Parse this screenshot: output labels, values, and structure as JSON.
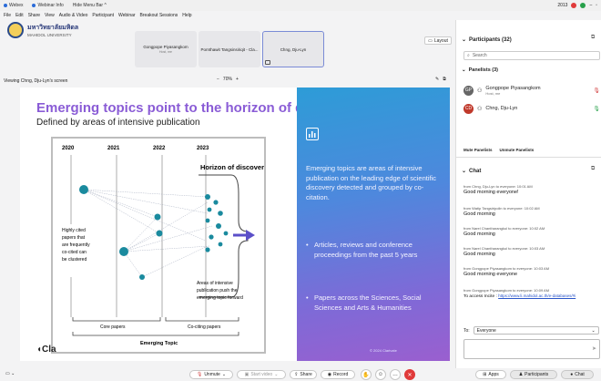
{
  "topbar": {
    "items": [
      "Webex",
      "Webinar Info",
      "Hide Menu Bar ^"
    ],
    "time": "2013",
    "status_colors": {
      "red": "#e03a3a",
      "green": "#27a04a"
    }
  },
  "menu": [
    "File",
    "Edit",
    "Share",
    "View",
    "Audio & Video",
    "Participant",
    "Webinar",
    "Breakout Sessions",
    "Help"
  ],
  "org": {
    "name": "มหาวิทยาลัยมหิดล",
    "sub": "MAHIDOL UNIVERSITY"
  },
  "thumbnails": [
    {
      "name": "Gongpope Piyasangkom",
      "sub": "Host, me"
    },
    {
      "name": "Pornthawit Tangsinsiriqit - Cla...",
      "sub": ""
    },
    {
      "name": "Chng, Dju-Lyn",
      "sub": ""
    }
  ],
  "layout_label": "Layout",
  "viewing": {
    "label": "Viewing Chng, Dju-Lyn's screen",
    "zoom_minus": "−",
    "zoom": "70%",
    "zoom_plus": "+"
  },
  "slide": {
    "title": "Emerging topics point to the horizon of discovery",
    "subtitle": "Defined by areas of intensive publication",
    "diagram": {
      "years": [
        "2020",
        "2021",
        "2022",
        "2023"
      ],
      "horizon_label": "Horizon of discovery",
      "highly_cited": "Highly cited papers that are frequently co-cited can be clustered",
      "areas_text": "Areas of intensive publication push the emerging topic forward",
      "core_papers": "Core papers",
      "co_citing": "Co-citing papers",
      "emerging_topic": "Emerging Topic"
    },
    "brand_fragment": "Cla",
    "right_paragraph": "Emerging topics are areas of intensive publication on the leading edge of scientific discovery detected and grouped by co-citation.",
    "bullets": [
      "Articles, reviews and conference proceedings from the past 5 years",
      "Papers across the Sciences, Social Sciences and Arts & Humanities"
    ],
    "copyright": "© 2024 Clarivate"
  },
  "participants": {
    "header": "Participants (32)",
    "search_placeholder": "Search",
    "panelists_header": "Panelists (3)",
    "panelists": [
      {
        "name": "Gongpope Piyasangkom",
        "sub": "Host, me",
        "initials": "GP",
        "color": "#555"
      },
      {
        "name": "Chng, Dju-Lyn",
        "sub": "",
        "initials": "CD",
        "color": "#c0392b"
      }
    ],
    "mute_panelists": "Mute Panelists",
    "unmute_panelists": "Unmute Panelists"
  },
  "chat": {
    "header": "Chat",
    "messages": [
      {
        "from": "from Chng, Dju-Lyn to everyone:   10:01 AM",
        "text": "Good morning everyone!"
      },
      {
        "from": "from Watip Tangsiripolin to everyone:   10:02 AM",
        "text": "Good morning"
      },
      {
        "from": "from Narel Chantharangkul to everyone:   10:02 AM",
        "text": "Good morning"
      },
      {
        "from": "from Narel Chantharangkul to everyone:   10:03 AM",
        "text": "Good morning"
      },
      {
        "from": "from Gongpope Piyasangkom to everyone:   10:03 AM",
        "text": "Good morning everyone"
      },
      {
        "from": "from Gongpope Piyasangkom to everyone:   10:09 AM",
        "text": "To access Incite :",
        "link": "https://www.li.mahidol.ac.th/e-databases/#i"
      }
    ],
    "to_label": "To:",
    "to_value": "Everyone"
  },
  "bottom": {
    "unmute": "Unmute",
    "start_video": "Start video",
    "share": "Share",
    "record": "Record",
    "apps": "Apps",
    "participants": "Participants",
    "chat": "Chat"
  }
}
